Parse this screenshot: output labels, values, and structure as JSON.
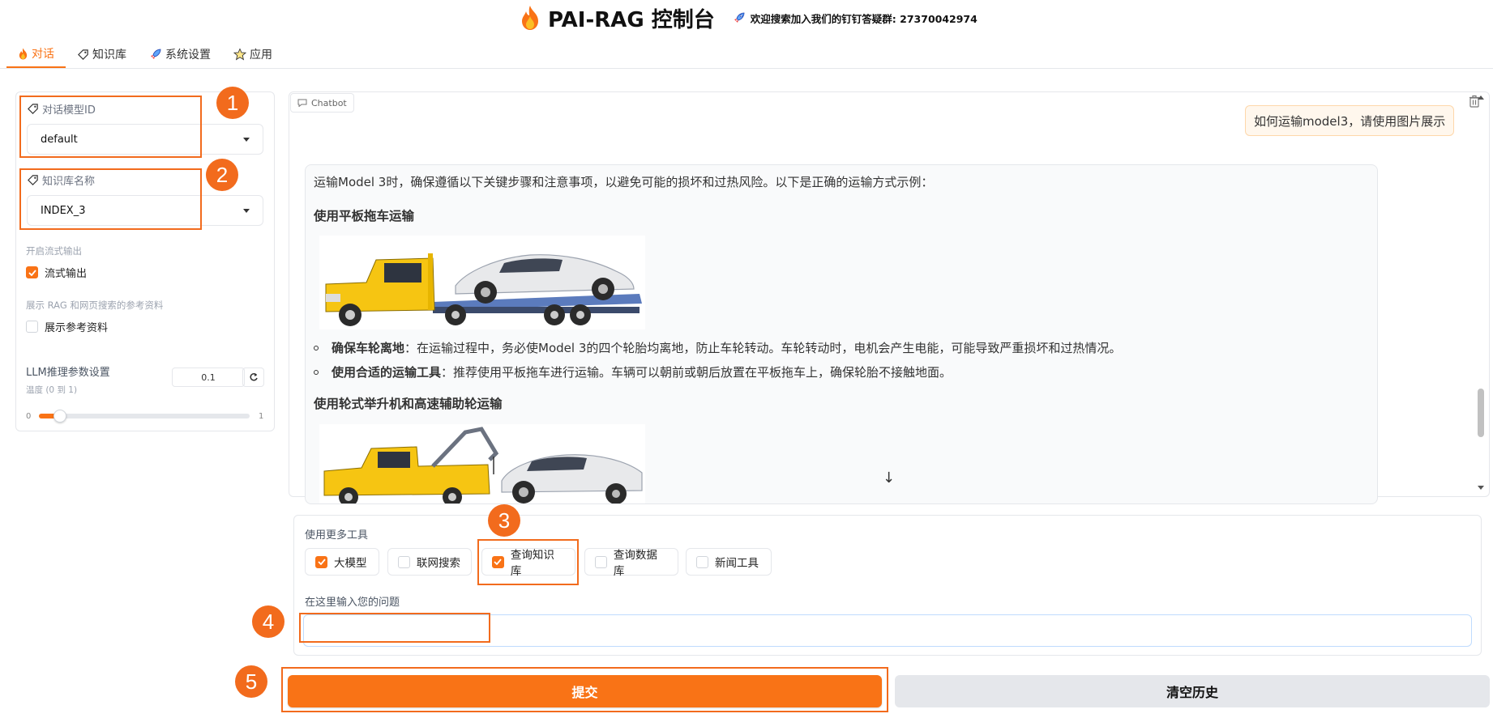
{
  "header": {
    "title": "PAI-RAG 控制台",
    "announcement": "欢迎搜索加入我们的钉钉答疑群: 27370042974"
  },
  "tabs": [
    {
      "label": "对话",
      "icon": "flame-icon",
      "active": true
    },
    {
      "label": "知识库",
      "icon": "tag-icon",
      "active": false
    },
    {
      "label": "系统设置",
      "icon": "rocket-icon",
      "active": false
    },
    {
      "label": "应用",
      "icon": "star-icon",
      "active": false
    }
  ],
  "sidebar": {
    "model_label": "对话模型ID",
    "model_value": "default",
    "kb_label": "知识库名称",
    "kb_value": "INDEX_3",
    "stream_section": "开启流式输出",
    "stream_checkbox": "流式输出",
    "stream_checked": true,
    "ref_section": "展示 RAG 和网页搜索的参考资料",
    "ref_checkbox": "展示参考资料",
    "ref_checked": false,
    "llm_label": "LLM推理参数设置",
    "temp_label": "温度 (0 到 1)",
    "temp_value": "0.1",
    "slider_min": "0",
    "slider_max": "1",
    "slider_fraction": 0.1
  },
  "chat": {
    "tag": "Chatbot",
    "user_message": "如何运输model3，请使用图片展示",
    "bot_intro": "运输Model 3时，确保遵循以下关键步骤和注意事项，以避免可能的损坏和过热风险。以下是正确的运输方式示例：",
    "heading1": "使用平板拖车运输",
    "bullets": [
      {
        "bold": "确保车轮离地",
        "text": "：在运输过程中，务必使Model 3的四个轮胎均离地，防止车轮转动。车轮转动时，电机会产生电能，可能导致严重损坏和过热情况。"
      },
      {
        "bold": "使用合适的运输工具",
        "text": "：推荐使用平板拖车进行运输。车辆可以朝前或朝后放置在平板拖车上，确保轮胎不接触地面。"
      }
    ],
    "heading2": "使用轮式举升机和高速辅助轮运输"
  },
  "tools": {
    "label": "使用更多工具",
    "items": [
      {
        "label": "大模型",
        "checked": true
      },
      {
        "label": "联网搜索",
        "checked": false
      },
      {
        "label": "查询知识库",
        "checked": true
      },
      {
        "label": "查询数据库",
        "checked": false
      },
      {
        "label": "新闻工具",
        "checked": false
      }
    ],
    "question_label": "在这里输入您的问题",
    "question_value": ""
  },
  "actions": {
    "submit": "提交",
    "clear": "清空历史"
  },
  "badges": [
    "1",
    "2",
    "3",
    "4",
    "5"
  ],
  "colors": {
    "accent": "#f97316",
    "highlight": "#f26b1d"
  }
}
